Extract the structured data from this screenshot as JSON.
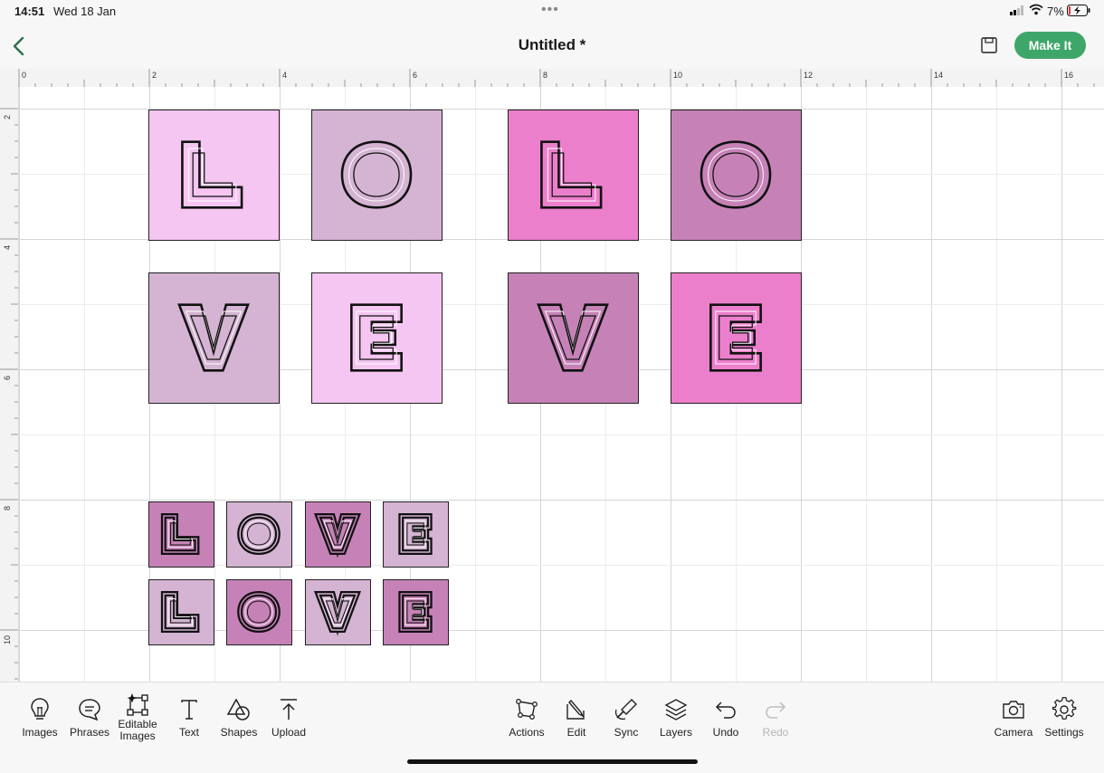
{
  "status_bar": {
    "time": "14:51",
    "date": "Wed 18 Jan",
    "battery": "7%"
  },
  "header": {
    "title": "Untitled *",
    "make_it_label": "Make It"
  },
  "ruler": {
    "top": [
      "0",
      "2",
      "4",
      "6",
      "8",
      "10",
      "12",
      "14",
      "16"
    ],
    "left": [
      "2",
      "4",
      "6",
      "8",
      "10"
    ]
  },
  "colors": {
    "light_pink": "#f4c6f1",
    "mauve": "#d4b4d2",
    "hot_pink": "#ec7fcc",
    "dark_mauve": "#c682b7",
    "accent_green": "#3fa66a"
  },
  "canvas": {
    "tiles": [
      {
        "letter": "L",
        "color": "light_pink"
      },
      {
        "letter": "O",
        "color": "mauve"
      },
      {
        "letter": "L",
        "color": "hot_pink"
      },
      {
        "letter": "O",
        "color": "dark_mauve"
      },
      {
        "letter": "V",
        "color": "mauve"
      },
      {
        "letter": "E",
        "color": "light_pink"
      },
      {
        "letter": "V",
        "color": "dark_mauve"
      },
      {
        "letter": "E",
        "color": "hot_pink"
      },
      {
        "letter": "L",
        "color": "dark_mauve"
      },
      {
        "letter": "O",
        "color": "mauve"
      },
      {
        "letter": "V",
        "color": "dark_mauve"
      },
      {
        "letter": "E",
        "color": "mauve"
      },
      {
        "letter": "L",
        "color": "mauve"
      },
      {
        "letter": "O",
        "color": "dark_mauve"
      },
      {
        "letter": "V",
        "color": "mauve"
      },
      {
        "letter": "E",
        "color": "dark_mauve"
      }
    ]
  },
  "toolbar": {
    "images": "Images",
    "phrases": "Phrases",
    "editable_images_1": "Editable",
    "editable_images_2": "Images",
    "text": "Text",
    "shapes": "Shapes",
    "upload": "Upload",
    "actions": "Actions",
    "edit": "Edit",
    "sync": "Sync",
    "layers": "Layers",
    "undo": "Undo",
    "redo": "Redo",
    "camera": "Camera",
    "settings": "Settings"
  }
}
